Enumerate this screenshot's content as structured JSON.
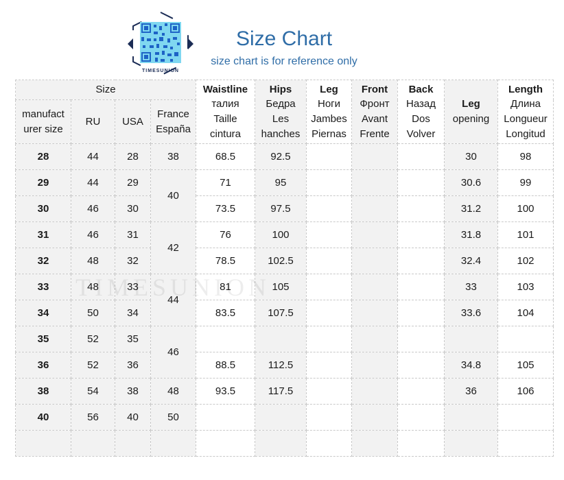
{
  "header": {
    "brand": "TIMESUNION",
    "title": "Size Chart",
    "subtitle": "size chart is for reference only"
  },
  "watermark": "TIMESUNION",
  "columns": {
    "size_group": "Size",
    "manufacturer": "manufact urer size",
    "ru": "RU",
    "usa": "USA",
    "france": "France España",
    "waist": {
      "title": "Waistline",
      "l1": "талия",
      "l2": "Taille",
      "l3": "cintura"
    },
    "hips": {
      "title": "Hips",
      "l1": "Бедра",
      "l2": "Les",
      "l3": "hanches"
    },
    "leg": {
      "title": "Leg",
      "l1": "Ноги",
      "l2": "Jambes",
      "l3": "Piernas"
    },
    "front": {
      "title": "Front",
      "l1": "Фронт",
      "l2": "Avant",
      "l3": "Frente"
    },
    "back": {
      "title": "Back",
      "l1": "Назад",
      "l2": "Dos",
      "l3": "Volver"
    },
    "leg_opening": {
      "title": "Leg",
      "l1": "opening"
    },
    "length": {
      "title": "Length",
      "l1": "Длина",
      "l2": "Longueur",
      "l3": "Longitud"
    }
  },
  "rows": [
    {
      "mfr": "28",
      "ru": "44",
      "usa": "28",
      "fr": "38",
      "waist": "68.5",
      "hips": "92.5",
      "leg": "",
      "front": "",
      "back": "",
      "opening": "30",
      "length": "98"
    },
    {
      "mfr": "29",
      "ru": "44",
      "usa": "29",
      "fr": "40",
      "waist": "71",
      "hips": "95",
      "leg": "",
      "front": "",
      "back": "",
      "opening": "30.6",
      "length": "99"
    },
    {
      "mfr": "30",
      "ru": "46",
      "usa": "30",
      "fr": "",
      "waist": "73.5",
      "hips": "97.5",
      "leg": "",
      "front": "",
      "back": "",
      "opening": "31.2",
      "length": "100"
    },
    {
      "mfr": "31",
      "ru": "46",
      "usa": "31",
      "fr": "42",
      "waist": "76",
      "hips": "100",
      "leg": "",
      "front": "",
      "back": "",
      "opening": "31.8",
      "length": "101"
    },
    {
      "mfr": "32",
      "ru": "48",
      "usa": "32",
      "fr": "",
      "waist": "78.5",
      "hips": "102.5",
      "leg": "",
      "front": "",
      "back": "",
      "opening": "32.4",
      "length": "102"
    },
    {
      "mfr": "33",
      "ru": "48",
      "usa": "33",
      "fr": "44",
      "waist": "81",
      "hips": "105",
      "leg": "",
      "front": "",
      "back": "",
      "opening": "33",
      "length": "103"
    },
    {
      "mfr": "34",
      "ru": "50",
      "usa": "34",
      "fr": "",
      "waist": "83.5",
      "hips": "107.5",
      "leg": "",
      "front": "",
      "back": "",
      "opening": "33.6",
      "length": "104"
    },
    {
      "mfr": "35",
      "ru": "52",
      "usa": "35",
      "fr": "46",
      "waist": "",
      "hips": "",
      "leg": "",
      "front": "",
      "back": "",
      "opening": "",
      "length": ""
    },
    {
      "mfr": "36",
      "ru": "52",
      "usa": "36",
      "fr": "",
      "waist": "88.5",
      "hips": "112.5",
      "leg": "",
      "front": "",
      "back": "",
      "opening": "34.8",
      "length": "105"
    },
    {
      "mfr": "38",
      "ru": "54",
      "usa": "38",
      "fr": "48",
      "waist": "93.5",
      "hips": "117.5",
      "leg": "",
      "front": "",
      "back": "",
      "opening": "36",
      "length": "106"
    },
    {
      "mfr": "40",
      "ru": "56",
      "usa": "40",
      "fr": "50",
      "waist": "",
      "hips": "",
      "leg": "",
      "front": "",
      "back": "",
      "opening": "",
      "length": ""
    }
  ]
}
